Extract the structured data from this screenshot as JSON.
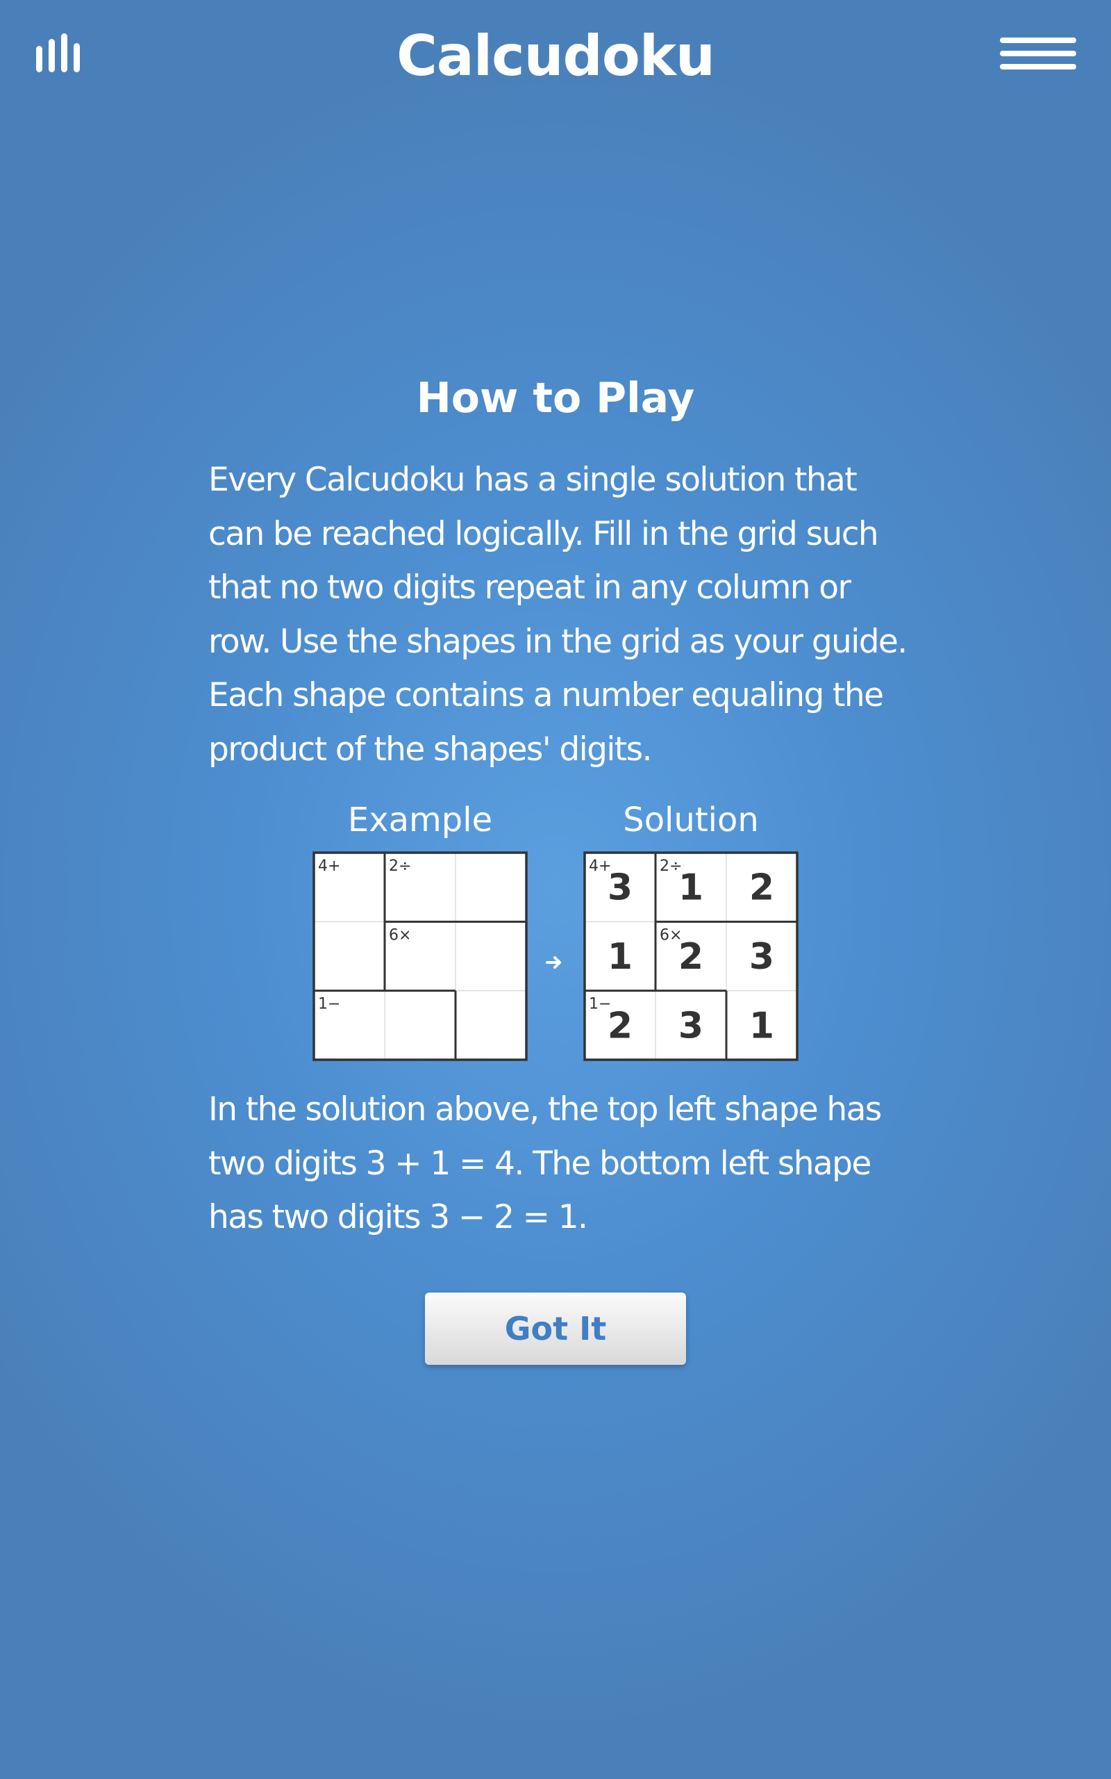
{
  "header": {
    "title": "Calcudoku",
    "stats_icon": "stats-bars-icon",
    "menu_icon": "hamburger-menu-icon"
  },
  "dialog": {
    "heading": "How to Play",
    "intro": "Every Calcudoku has a single solution that can be reached logically. Fill in the grid such that no two digits repeat in any column or row. Use the shapes in the grid as your guide. Each shape contains a number equaling the product of the shapes' digits.",
    "example_label": "Example",
    "solution_label": "Solution",
    "arrow_icon": "arrow-right-icon",
    "explanation": "In the solution above, the top left shape has two digits 3 + 1 = 4. The bottom left shape has two digits 3 − 2 = 1.",
    "button_label": "Got It"
  },
  "puzzle": {
    "size": 3,
    "cages": [
      {
        "clue": "4+",
        "cells": [
          [
            0,
            0
          ],
          [
            1,
            0
          ]
        ]
      },
      {
        "clue": "2÷",
        "cells": [
          [
            0,
            1
          ],
          [
            0,
            2
          ]
        ]
      },
      {
        "clue": "6×",
        "cells": [
          [
            1,
            1
          ],
          [
            1,
            2
          ],
          [
            2,
            2
          ]
        ]
      },
      {
        "clue": "1−",
        "cells": [
          [
            2,
            0
          ],
          [
            2,
            1
          ]
        ]
      }
    ],
    "solution": [
      [
        3,
        1,
        2
      ],
      [
        1,
        2,
        3
      ],
      [
        2,
        3,
        1
      ]
    ]
  },
  "colors": {
    "background": "#4d8ed0",
    "text": "#ffffff",
    "button_text": "#3f7fc4",
    "grid_line": "#333333",
    "digit": "#333333"
  }
}
